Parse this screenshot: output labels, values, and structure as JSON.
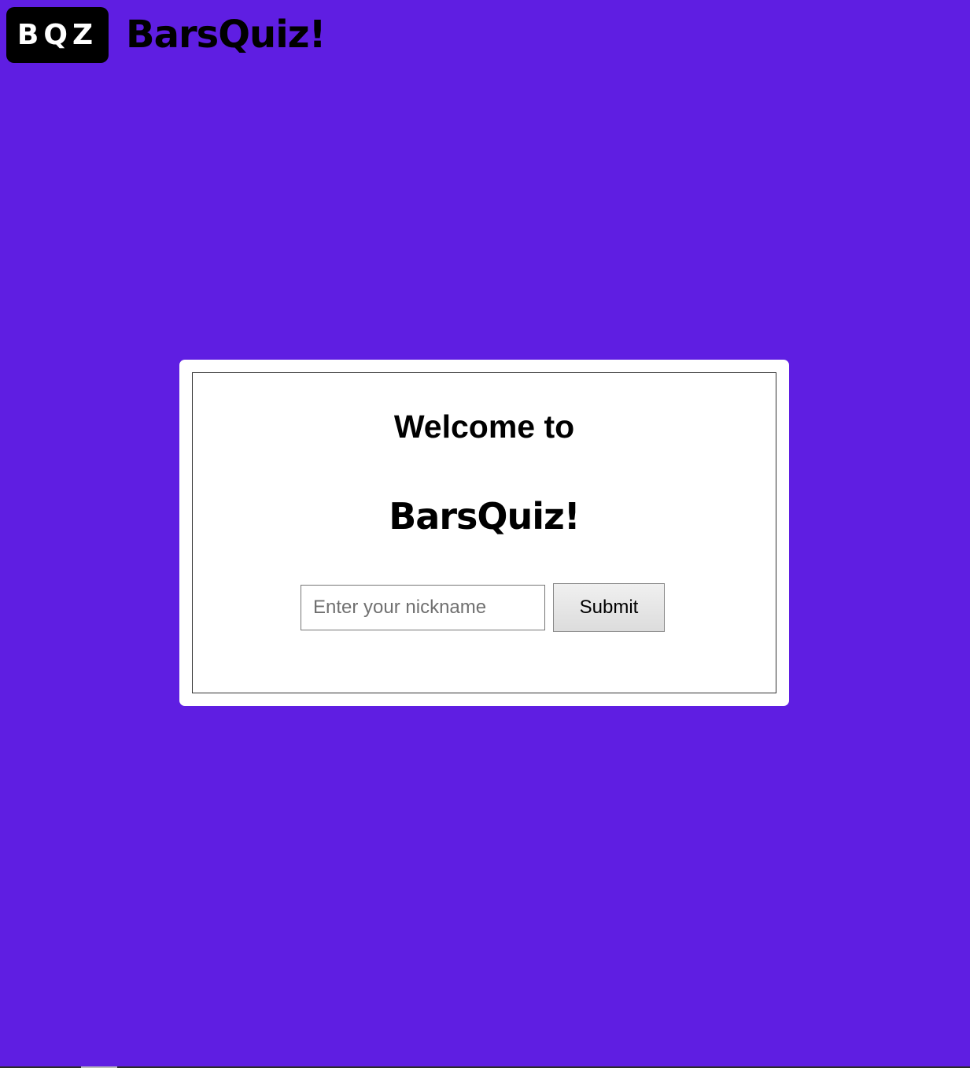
{
  "header": {
    "badge_text": "BQZ",
    "brand_text": "BarsQuiz!"
  },
  "card": {
    "heading": "Welcome to",
    "brand_text": "BarsQuiz!",
    "nickname_placeholder": "Enter your nickname",
    "nickname_value": "",
    "submit_label": "Submit"
  },
  "colors": {
    "background": "#5f1ee2",
    "card": "#ffffff",
    "badge": "#000000"
  }
}
